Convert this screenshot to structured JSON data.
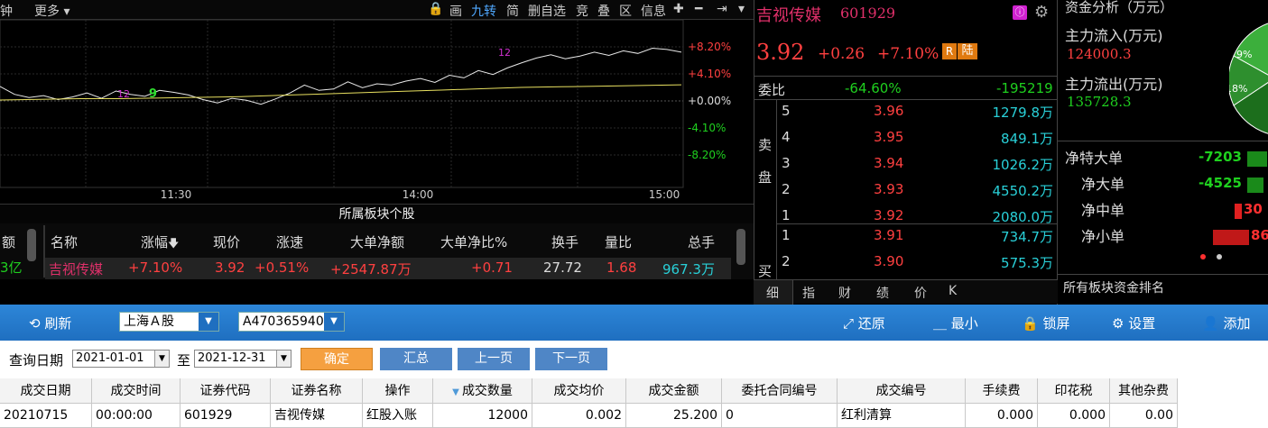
{
  "toolbar": {
    "left_partial": "钟",
    "more": "更多",
    "items": [
      "画",
      "九转",
      "简",
      "删自选",
      "竞",
      "叠",
      "区",
      "信息"
    ]
  },
  "chart": {
    "y_labels_right": [
      "+8.20%",
      "+4.10%",
      "+0.00%",
      "-4.10%",
      "-8.20%"
    ],
    "x_labels": [
      "11:30",
      "14:00",
      "15:00"
    ],
    "marker_a": "12",
    "marker_b": "9",
    "marker_c": "12"
  },
  "board": {
    "title": "所属板块个股",
    "left_col_partial": "额",
    "left_val_partial": "3亿",
    "headers": [
      "名称",
      "涨幅",
      "现价",
      "涨速",
      "大单净额",
      "大单净比%",
      "换手",
      "量比",
      "总手"
    ],
    "row": [
      "吉视传媒",
      "+7.10%",
      "3.92",
      "+0.51%",
      "+2547.87万",
      "+0.71",
      "27.72",
      "1.68",
      "967.3万"
    ]
  },
  "quote": {
    "name": "吉视传媒",
    "code": "601929",
    "price": "3.92",
    "change": "+0.26",
    "pct": "+7.10%",
    "badge_r": "R",
    "badge_lu": "陆",
    "weibi_label": "委比",
    "weibi_pct": "-64.60%",
    "weibi_val": "-195219",
    "sell_label_1": "卖",
    "sell_label_2": "盘",
    "buy_label": "买",
    "asks": [
      {
        "lvl": "5",
        "price": "3.96",
        "vol": "1279.8万"
      },
      {
        "lvl": "4",
        "price": "3.95",
        "vol": "849.1万"
      },
      {
        "lvl": "3",
        "price": "3.94",
        "vol": "1026.2万"
      },
      {
        "lvl": "2",
        "price": "3.93",
        "vol": "4550.2万"
      },
      {
        "lvl": "1",
        "price": "3.92",
        "vol": "2080.0万"
      }
    ],
    "bids": [
      {
        "lvl": "1",
        "price": "3.91",
        "vol": "734.7万"
      },
      {
        "lvl": "2",
        "price": "3.90",
        "vol": "575.3万"
      }
    ],
    "tabs": [
      "细",
      "指",
      "财",
      "绩",
      "价",
      "K"
    ]
  },
  "fund": {
    "title": "资金分析（万元）",
    "inflow_label": "主力流入(万元)",
    "inflow": "124000.3",
    "outflow_label": "主力流出(万元)",
    "outflow": "135728.3",
    "pie_labels": [
      "9%",
      "18%"
    ],
    "rows": [
      {
        "label": "净特大单",
        "value": "-7203"
      },
      {
        "label": "净大单",
        "value": "-4525"
      },
      {
        "label": "净中单",
        "value": "30"
      },
      {
        "label": "净小单",
        "value": "86"
      }
    ],
    "footer": "所有板块资金排名"
  },
  "bluebar": {
    "refresh": "刷新",
    "market": "上海Ａ股",
    "account": "A470365940",
    "restore": "还原",
    "minimize": "最小",
    "lock": "锁屏",
    "settings": "设置",
    "add": "添加"
  },
  "query": {
    "label": "查询日期",
    "from": "2021-01-01",
    "to_label": "至",
    "to": "2021-12-31",
    "confirm": "确定",
    "summary": "汇总",
    "prev": "上一页",
    "next": "下一页"
  },
  "grid": {
    "headers": [
      "成交日期",
      "成交时间",
      "证券代码",
      "证券名称",
      "操作",
      "成交数量",
      "成交均价",
      "成交金额",
      "委托合同编号",
      "成交编号",
      "手续费",
      "印花税",
      "其他杂费"
    ],
    "row": [
      "20210715",
      "00:00:00",
      "601929",
      "吉视传媒",
      "红股入账",
      "12000",
      "0.002",
      "25.200",
      "0",
      "红利清算",
      "0.000",
      "0.000",
      "0.00"
    ]
  }
}
